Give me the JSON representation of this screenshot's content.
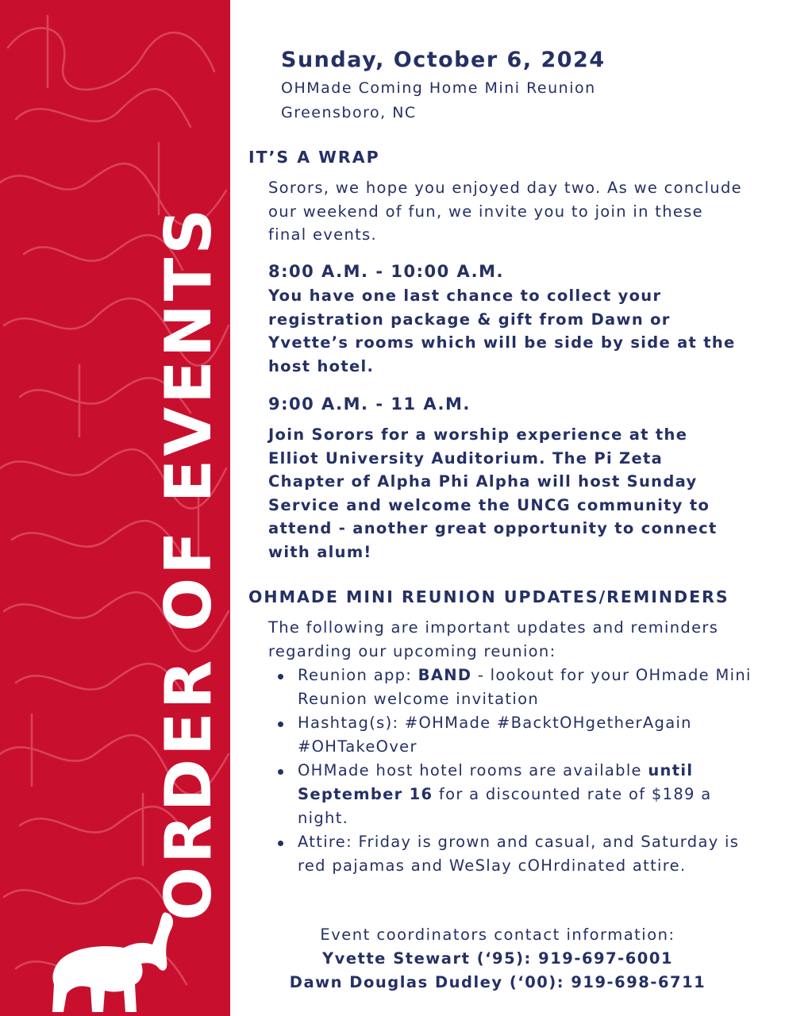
{
  "sidebar": {
    "vertical_title": "ORDER OF EVENTS",
    "background_color": "#c8102e",
    "logo_icon": "elephant-icon"
  },
  "header": {
    "date": "Sunday, October 6, 2024",
    "event": "OHMade Coming Home Mini Reunion",
    "location": "Greensboro, NC"
  },
  "wrap": {
    "heading": "IT’S A WRAP",
    "intro": "Sorors, we hope you enjoyed day two. As we conclude our weekend of fun, we invite you to join in these final events."
  },
  "events": [
    {
      "time": "8:00 A.M. - 10:00 A.M.",
      "description": "You have one last chance to collect your registration package & gift from Dawn or Yvette’s rooms which will be side by side at the host hotel."
    },
    {
      "time": "9:00 A.M. - 11 A.M.",
      "description": "Join Sorors for a worship experience at the Elliot University Auditorium. The Pi Zeta Chapter of Alpha Phi Alpha will host Sunday Service and welcome the UNCG community to attend - another great opportunity to connect with alum!"
    }
  ],
  "updates": {
    "heading": "OHMADE MINI REUNION UPDATES/REMINDERS",
    "intro": "The following are important updates and reminders regarding our upcoming reunion:",
    "bullets": [
      {
        "pre": "Reunion app: ",
        "bold": "BAND",
        "post": " - lookout for your OHmade Mini Reunion welcome invitation"
      },
      {
        "pre": "Hashtag(s): #OHMade #BacktOHgetherAgain #OHTakeOver",
        "bold": "",
        "post": ""
      },
      {
        "pre": "OHMade host hotel rooms are available ",
        "bold": "until September 16",
        "post": " for a discounted rate of $189 a night."
      },
      {
        "pre": "Attire: Friday is grown and casual, and Saturday is red pajamas and WeSlay cOHrdinated attire.",
        "bold": "",
        "post": ""
      }
    ]
  },
  "contacts": {
    "heading": "Event coordinators contact information:",
    "people": [
      "Yvette Stewart (‘95): 919-697-6001",
      "Dawn Douglas Dudley (‘00): 919-698-6711"
    ]
  },
  "colors": {
    "navy_text": "#253064",
    "red": "#c8102e",
    "white": "#ffffff"
  }
}
